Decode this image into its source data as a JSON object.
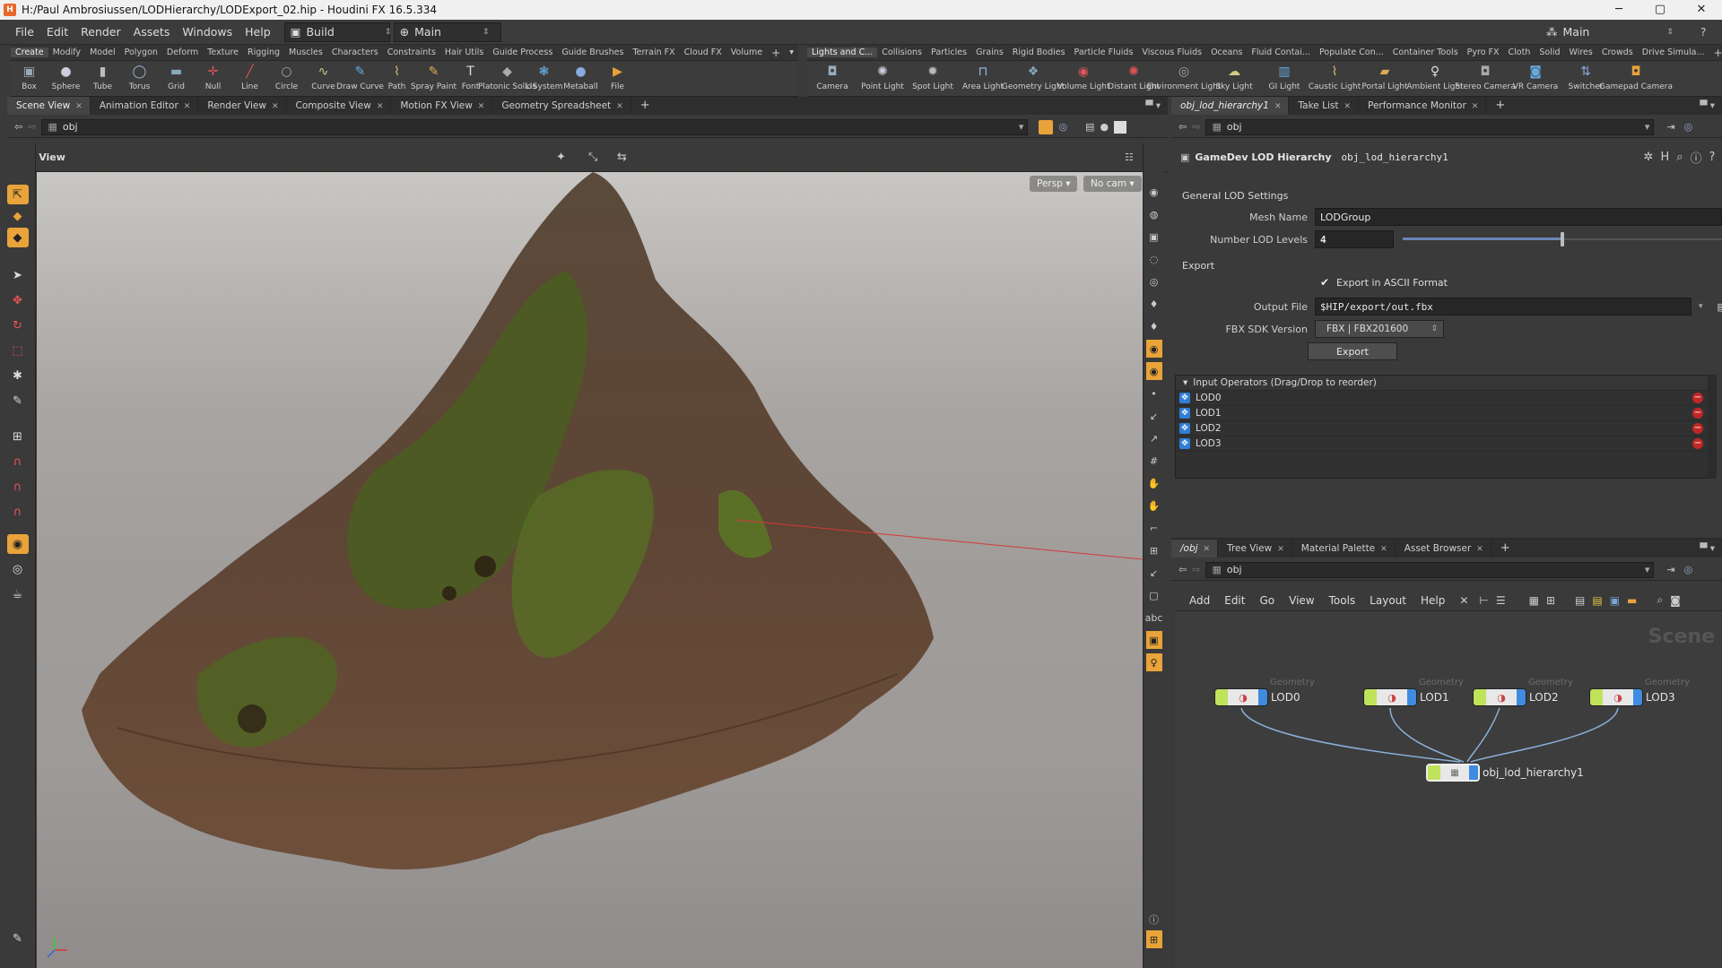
{
  "window": {
    "title": "H:/Paul Ambrosiussen/LODHierarchy/LODExport_02.hip - Houdini FX 16.5.334",
    "app_icon": "houdini-icon",
    "buttons": [
      "─",
      "▢",
      "✕"
    ]
  },
  "menubar": {
    "items": [
      "File",
      "Edit",
      "Render",
      "Assets",
      "Windows",
      "Help"
    ],
    "desktop": "Build",
    "context": "Main",
    "right_context": "Main"
  },
  "shelf_left": {
    "tabs": [
      "Create",
      "Modify",
      "Model",
      "Polygon",
      "Deform",
      "Texture",
      "Rigging",
      "Muscles",
      "Characters",
      "Constraints",
      "Hair Utils",
      "Guide Process",
      "Guide Brushes",
      "Terrain FX",
      "Cloud FX",
      "Volume"
    ],
    "tools": [
      {
        "label": "Box",
        "icon": "box-icon"
      },
      {
        "label": "Sphere",
        "icon": "sphere-icon"
      },
      {
        "label": "Tube",
        "icon": "tube-icon"
      },
      {
        "label": "Torus",
        "icon": "torus-icon"
      },
      {
        "label": "Grid",
        "icon": "grid-icon"
      },
      {
        "label": "Null",
        "icon": "null-icon"
      },
      {
        "label": "Line",
        "icon": "line-icon"
      },
      {
        "label": "Circle",
        "icon": "circle-icon"
      },
      {
        "label": "Curve",
        "icon": "curve-icon"
      },
      {
        "label": "Draw Curve",
        "icon": "draw-curve-icon"
      },
      {
        "label": "Path",
        "icon": "path-icon"
      },
      {
        "label": "Spray Paint",
        "icon": "spray-paint-icon"
      },
      {
        "label": "Font",
        "icon": "font-icon"
      },
      {
        "label": "Platonic Solids",
        "icon": "platonic-icon"
      },
      {
        "label": "L-System",
        "icon": "lsystem-icon"
      },
      {
        "label": "Metaball",
        "icon": "metaball-icon"
      },
      {
        "label": "File",
        "icon": "file-icon"
      }
    ]
  },
  "shelf_right": {
    "tabs": [
      "Lights and C...",
      "Collisions",
      "Particles",
      "Grains",
      "Rigid Bodies",
      "Particle Fluids",
      "Viscous Fluids",
      "Oceans",
      "Fluid Contai...",
      "Populate Con...",
      "Container Tools",
      "Pyro FX",
      "Cloth",
      "Solid",
      "Wires",
      "Crowds",
      "Drive Simula..."
    ],
    "tools": [
      {
        "label": "Camera",
        "icon": "camera-icon"
      },
      {
        "label": "Point Light",
        "icon": "point-light-icon"
      },
      {
        "label": "Spot Light",
        "icon": "spot-light-icon"
      },
      {
        "label": "Area Light",
        "icon": "area-light-icon"
      },
      {
        "label": "Geometry Light",
        "icon": "geometry-light-icon"
      },
      {
        "label": "Volume Light",
        "icon": "volume-light-icon"
      },
      {
        "label": "Distant Light",
        "icon": "distant-light-icon"
      },
      {
        "label": "Environment Light",
        "icon": "environment-light-icon"
      },
      {
        "label": "Sky Light",
        "icon": "sky-light-icon"
      },
      {
        "label": "GI Light",
        "icon": "gi-light-icon"
      },
      {
        "label": "Caustic Light",
        "icon": "caustic-light-icon"
      },
      {
        "label": "Portal Light",
        "icon": "portal-light-icon"
      },
      {
        "label": "Ambient Light",
        "icon": "ambient-light-icon"
      },
      {
        "label": "Stereo Camera",
        "icon": "stereo-camera-icon"
      },
      {
        "label": "VR Camera",
        "icon": "vr-camera-icon"
      },
      {
        "label": "Switcher",
        "icon": "switcher-icon"
      },
      {
        "label": "Gamepad Camera",
        "icon": "gamepad-camera-icon"
      }
    ]
  },
  "left_pane": {
    "tabs": [
      "Scene View",
      "Animation Editor",
      "Render View",
      "Composite View",
      "Motion FX View",
      "Geometry Spreadsheet"
    ],
    "path": "obj",
    "view_label": "View",
    "persp_button": "Persp ▾",
    "cam_button": "No cam ▾"
  },
  "right_top_pane": {
    "tabs": [
      "obj_lod_hierarchy1",
      "Take List",
      "Performance Monitor"
    ],
    "path": "obj"
  },
  "params": {
    "node_type": "GameDev LOD Hierarchy",
    "node_name": "obj_lod_hierarchy1",
    "general_section": "General LOD Settings",
    "mesh_name_label": "Mesh Name",
    "mesh_name": "LODGroup",
    "lod_levels_label": "Number LOD Levels",
    "lod_levels": "4",
    "lod_slider_fraction": 0.5,
    "export_section": "Export",
    "ascii_label": "Export in ASCII Format",
    "ascii_checked": "✔",
    "output_label": "Output File",
    "output_file": "$HIP/export/out.fbx",
    "fbx_label": "FBX SDK Version",
    "fbx_version": "FBX | FBX201600",
    "export_button": "Export",
    "inputs_header": "Input Operators (Drag/Drop to reorder)",
    "inputs": [
      "LOD0",
      "LOD1",
      "LOD2",
      "LOD3"
    ]
  },
  "network_pane": {
    "tabs": [
      "/obj",
      "Tree View",
      "Material Palette",
      "Asset Browser"
    ],
    "path": "obj",
    "menu": [
      "Add",
      "Edit",
      "Go",
      "View",
      "Tools",
      "Layout",
      "Help"
    ],
    "watermark": "Scene",
    "nodes": [
      {
        "name": "LOD0",
        "type": "Geometry"
      },
      {
        "name": "LOD1",
        "type": "Geometry"
      },
      {
        "name": "LOD2",
        "type": "Geometry"
      },
      {
        "name": "LOD3",
        "type": "Geometry"
      }
    ],
    "output_node": "obj_lod_hierarchy1"
  },
  "colors": {
    "accent": "#e8a33a",
    "node_green": "#bfe35a",
    "node_blue": "#3f8be0",
    "delete_red": "#c02828"
  }
}
